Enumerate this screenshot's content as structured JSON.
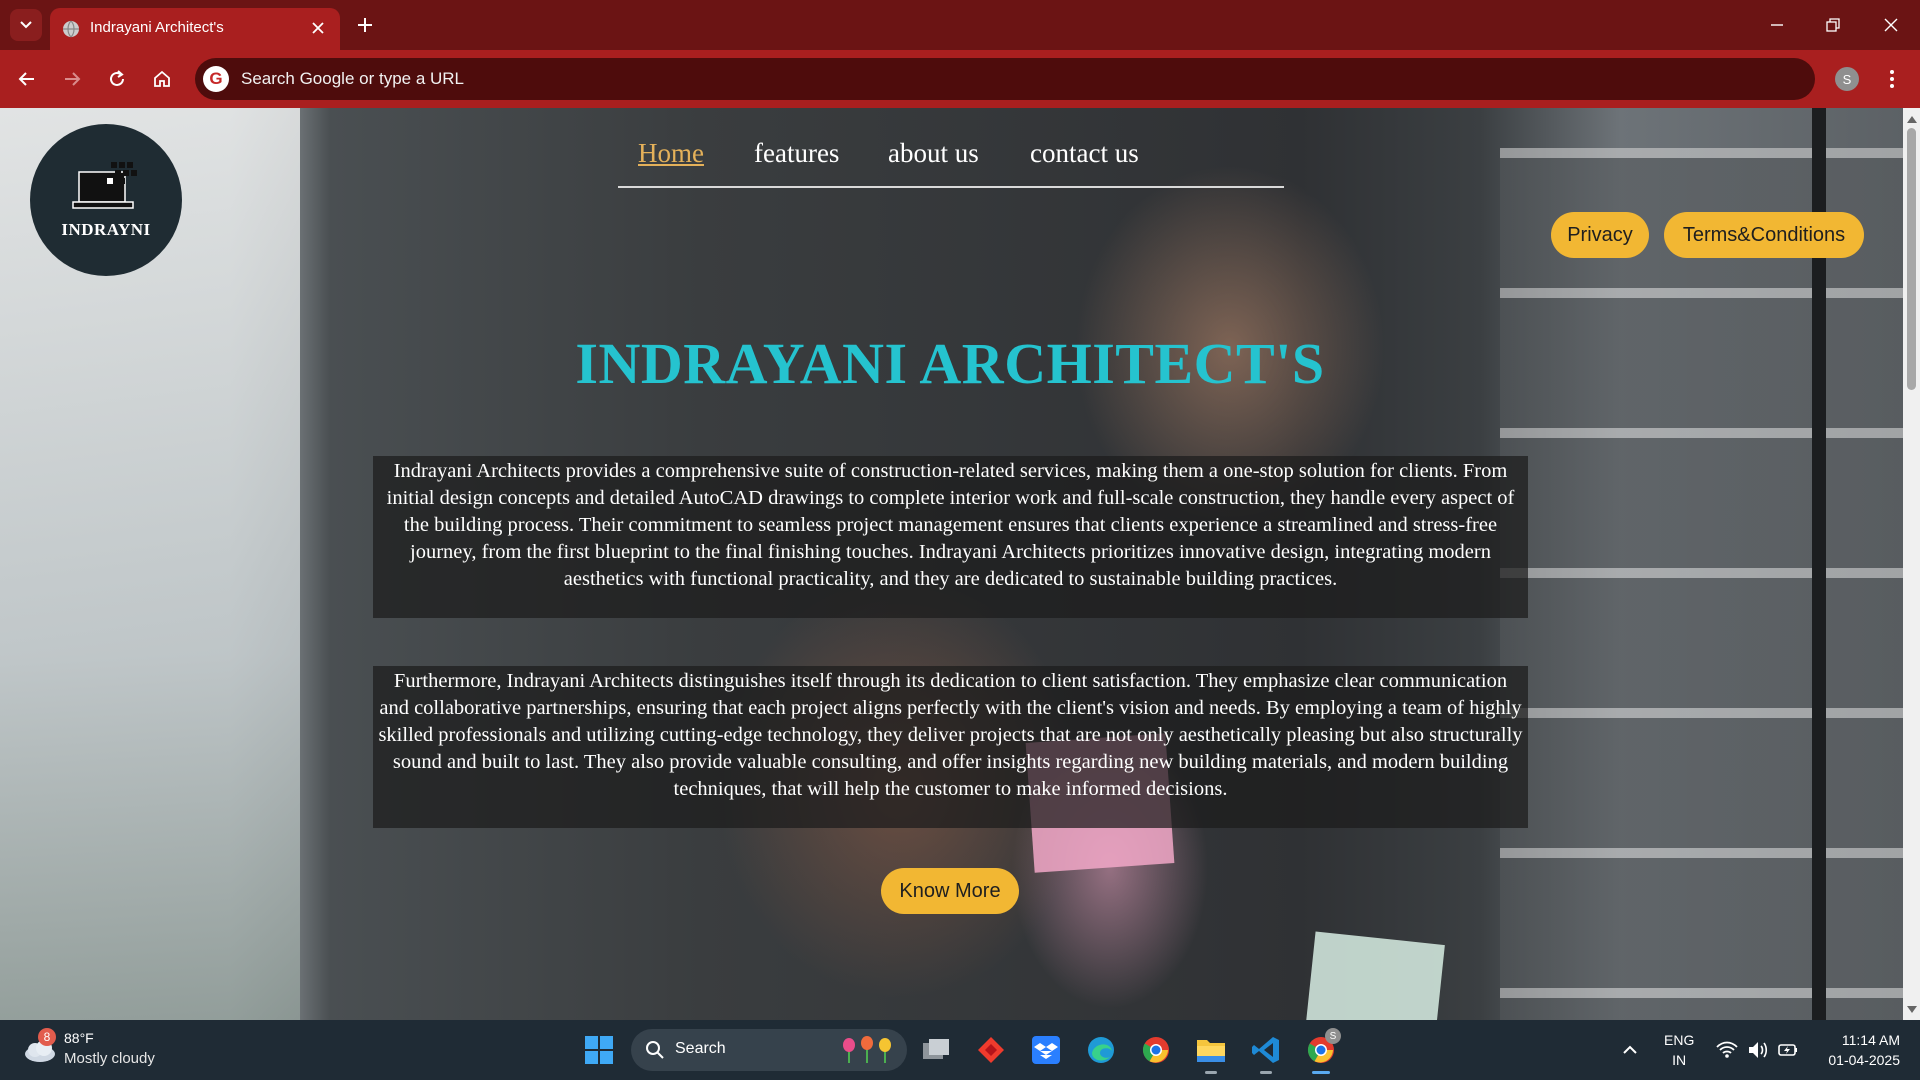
{
  "browser": {
    "tab_title": "Indrayani Architect's",
    "omnibox_placeholder": "Search Google or type a URL",
    "profile_initial": "S",
    "accent": "#a91f1f"
  },
  "site": {
    "logo_text": "INDRAYNI",
    "nav": [
      "Home",
      "features",
      "about us",
      "contact us"
    ],
    "privacy_label": "Privacy",
    "terms_label": "Terms&Conditions",
    "hero_title": "INDRAYANI ARCHITECT'S",
    "para1": "Indrayani Architects provides a comprehensive suite of construction-related services, making them a one-stop solution for clients. From initial design concepts and detailed AutoCAD drawings to complete interior work and full-scale construction, they handle every aspect of the building process. Their commitment to seamless project management ensures that clients experience a streamlined and stress-free journey, from the first blueprint to the final finishing touches. Indrayani Architects prioritizes innovative design, integrating modern aesthetics with functional practicality, and they are dedicated to sustainable building practices.",
    "para2": "Furthermore, Indrayani Architects distinguishes itself through its dedication to client satisfaction. They emphasize clear communication and collaborative partnerships, ensuring that each project aligns perfectly with the client's vision and needs. By employing a team of highly skilled professionals and utilizing cutting-edge technology, they deliver projects that are not only aesthetically pleasing but also structurally sound and built to last. They also provide valuable consulting, and offer insights regarding new building materials, and modern building techniques, that will help the customer to make informed decisions.",
    "know_more_label": "Know More",
    "title_color": "#25c3cf",
    "button_color": "#f2b733"
  },
  "taskbar": {
    "weather_badge": "8",
    "weather_temp": "88°F",
    "weather_desc": "Mostly cloudy",
    "search_label": "Search",
    "lang_line1": "ENG",
    "lang_line2": "IN",
    "time": "11:14 AM",
    "date": "01-04-2025",
    "chrome_badge": "S"
  }
}
